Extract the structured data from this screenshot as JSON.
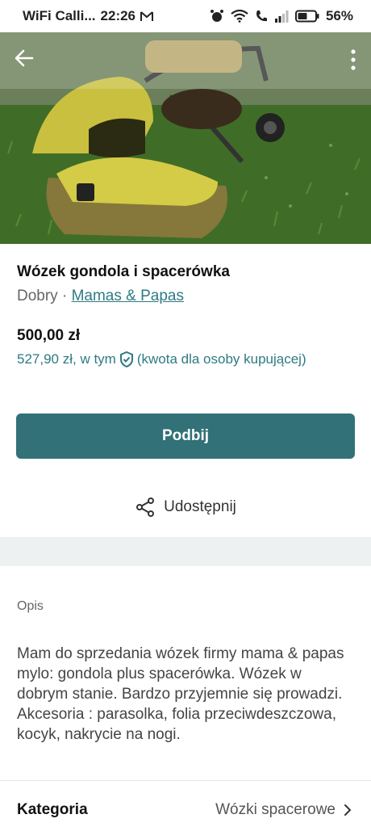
{
  "status_bar": {
    "carrier": "WiFi Calli...",
    "time": "22:26",
    "battery": "56%"
  },
  "item": {
    "title": "Wózek gondola i spacerówka",
    "condition": "Dobry",
    "separator": "·",
    "brand": "Mamas & Papas",
    "price": "500,00 zł",
    "total_price": "527,90 zł, w tym",
    "total_note": "(kwota dla osoby kupującej)"
  },
  "actions": {
    "bump_label": "Podbij",
    "share_label": "Udostępnij"
  },
  "description": {
    "label": "Opis",
    "text": "Mam do sprzedania wózek firmy mama & papas mylo: gondola plus spacerówka. Wózek w dobrym stanie. Bardzo przyjemnie się prowadzi. Akcesoria : parasolka, folia przeciwdeszczowa, kocyk, nakrycie na nogi."
  },
  "category": {
    "label": "Kategoria",
    "value": "Wózki spacerowe"
  },
  "colors": {
    "accent": "#317177",
    "link": "#2e7b82"
  },
  "icons": [
    "back-arrow-icon",
    "more-vertical-icon",
    "gmail-icon",
    "alarm-icon",
    "wifi-icon",
    "call-icon",
    "signal-icon",
    "battery-icon",
    "shield-check-icon",
    "share-icon",
    "chevron-right-icon"
  ]
}
